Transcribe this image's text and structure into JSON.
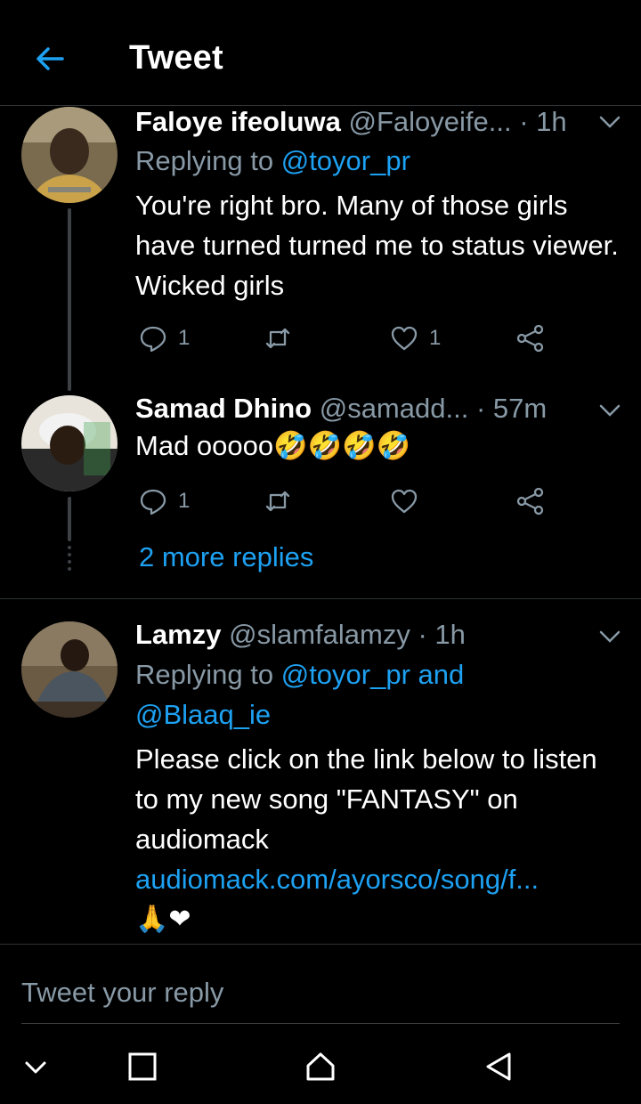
{
  "header": {
    "title": "Tweet"
  },
  "tweets": [
    {
      "name": "Faloye ifeoluwa",
      "handle": "@Faloyeife...",
      "time": "· 1h",
      "replying_prefix": "Replying to ",
      "replying_mentions": "@toyor_pr",
      "text": "You're right bro. Many of those girls have turned turned me to status viewer.  Wicked girls",
      "reply_count": "1",
      "retweet_count": "",
      "like_count": "1"
    },
    {
      "name": "Samad Dhino",
      "handle": "@samadd...",
      "time": "· 57m",
      "text": "Mad ooooo",
      "emoji": "🤣🤣🤣🤣",
      "reply_count": "1",
      "retweet_count": "",
      "like_count": ""
    },
    {
      "name": "Lamzy",
      "handle": "@slamfalamzy",
      "time": "· 1h",
      "replying_prefix": "Replying to ",
      "replying_mentions": "@toyor_pr and @Blaaq_ie",
      "text": "Please click on the link below to listen to my new song \"FANTASY\" on audiomack",
      "link": "audiomack.com/ayorsco/song/f...",
      "emoji_line": "🙏❤"
    }
  ],
  "more_replies": "2 more replies",
  "reply_box": {
    "placeholder": "Tweet your reply"
  },
  "colors": {
    "accent": "#1da1f2",
    "muted": "#8899a6",
    "background": "#000000",
    "divider": "#2f3336"
  },
  "icons": [
    "back-arrow-icon",
    "chevron-down-icon",
    "reply-icon",
    "retweet-icon",
    "like-icon",
    "share-icon",
    "nav-collapse-icon",
    "nav-recent-icon",
    "nav-home-icon",
    "nav-back-icon"
  ]
}
